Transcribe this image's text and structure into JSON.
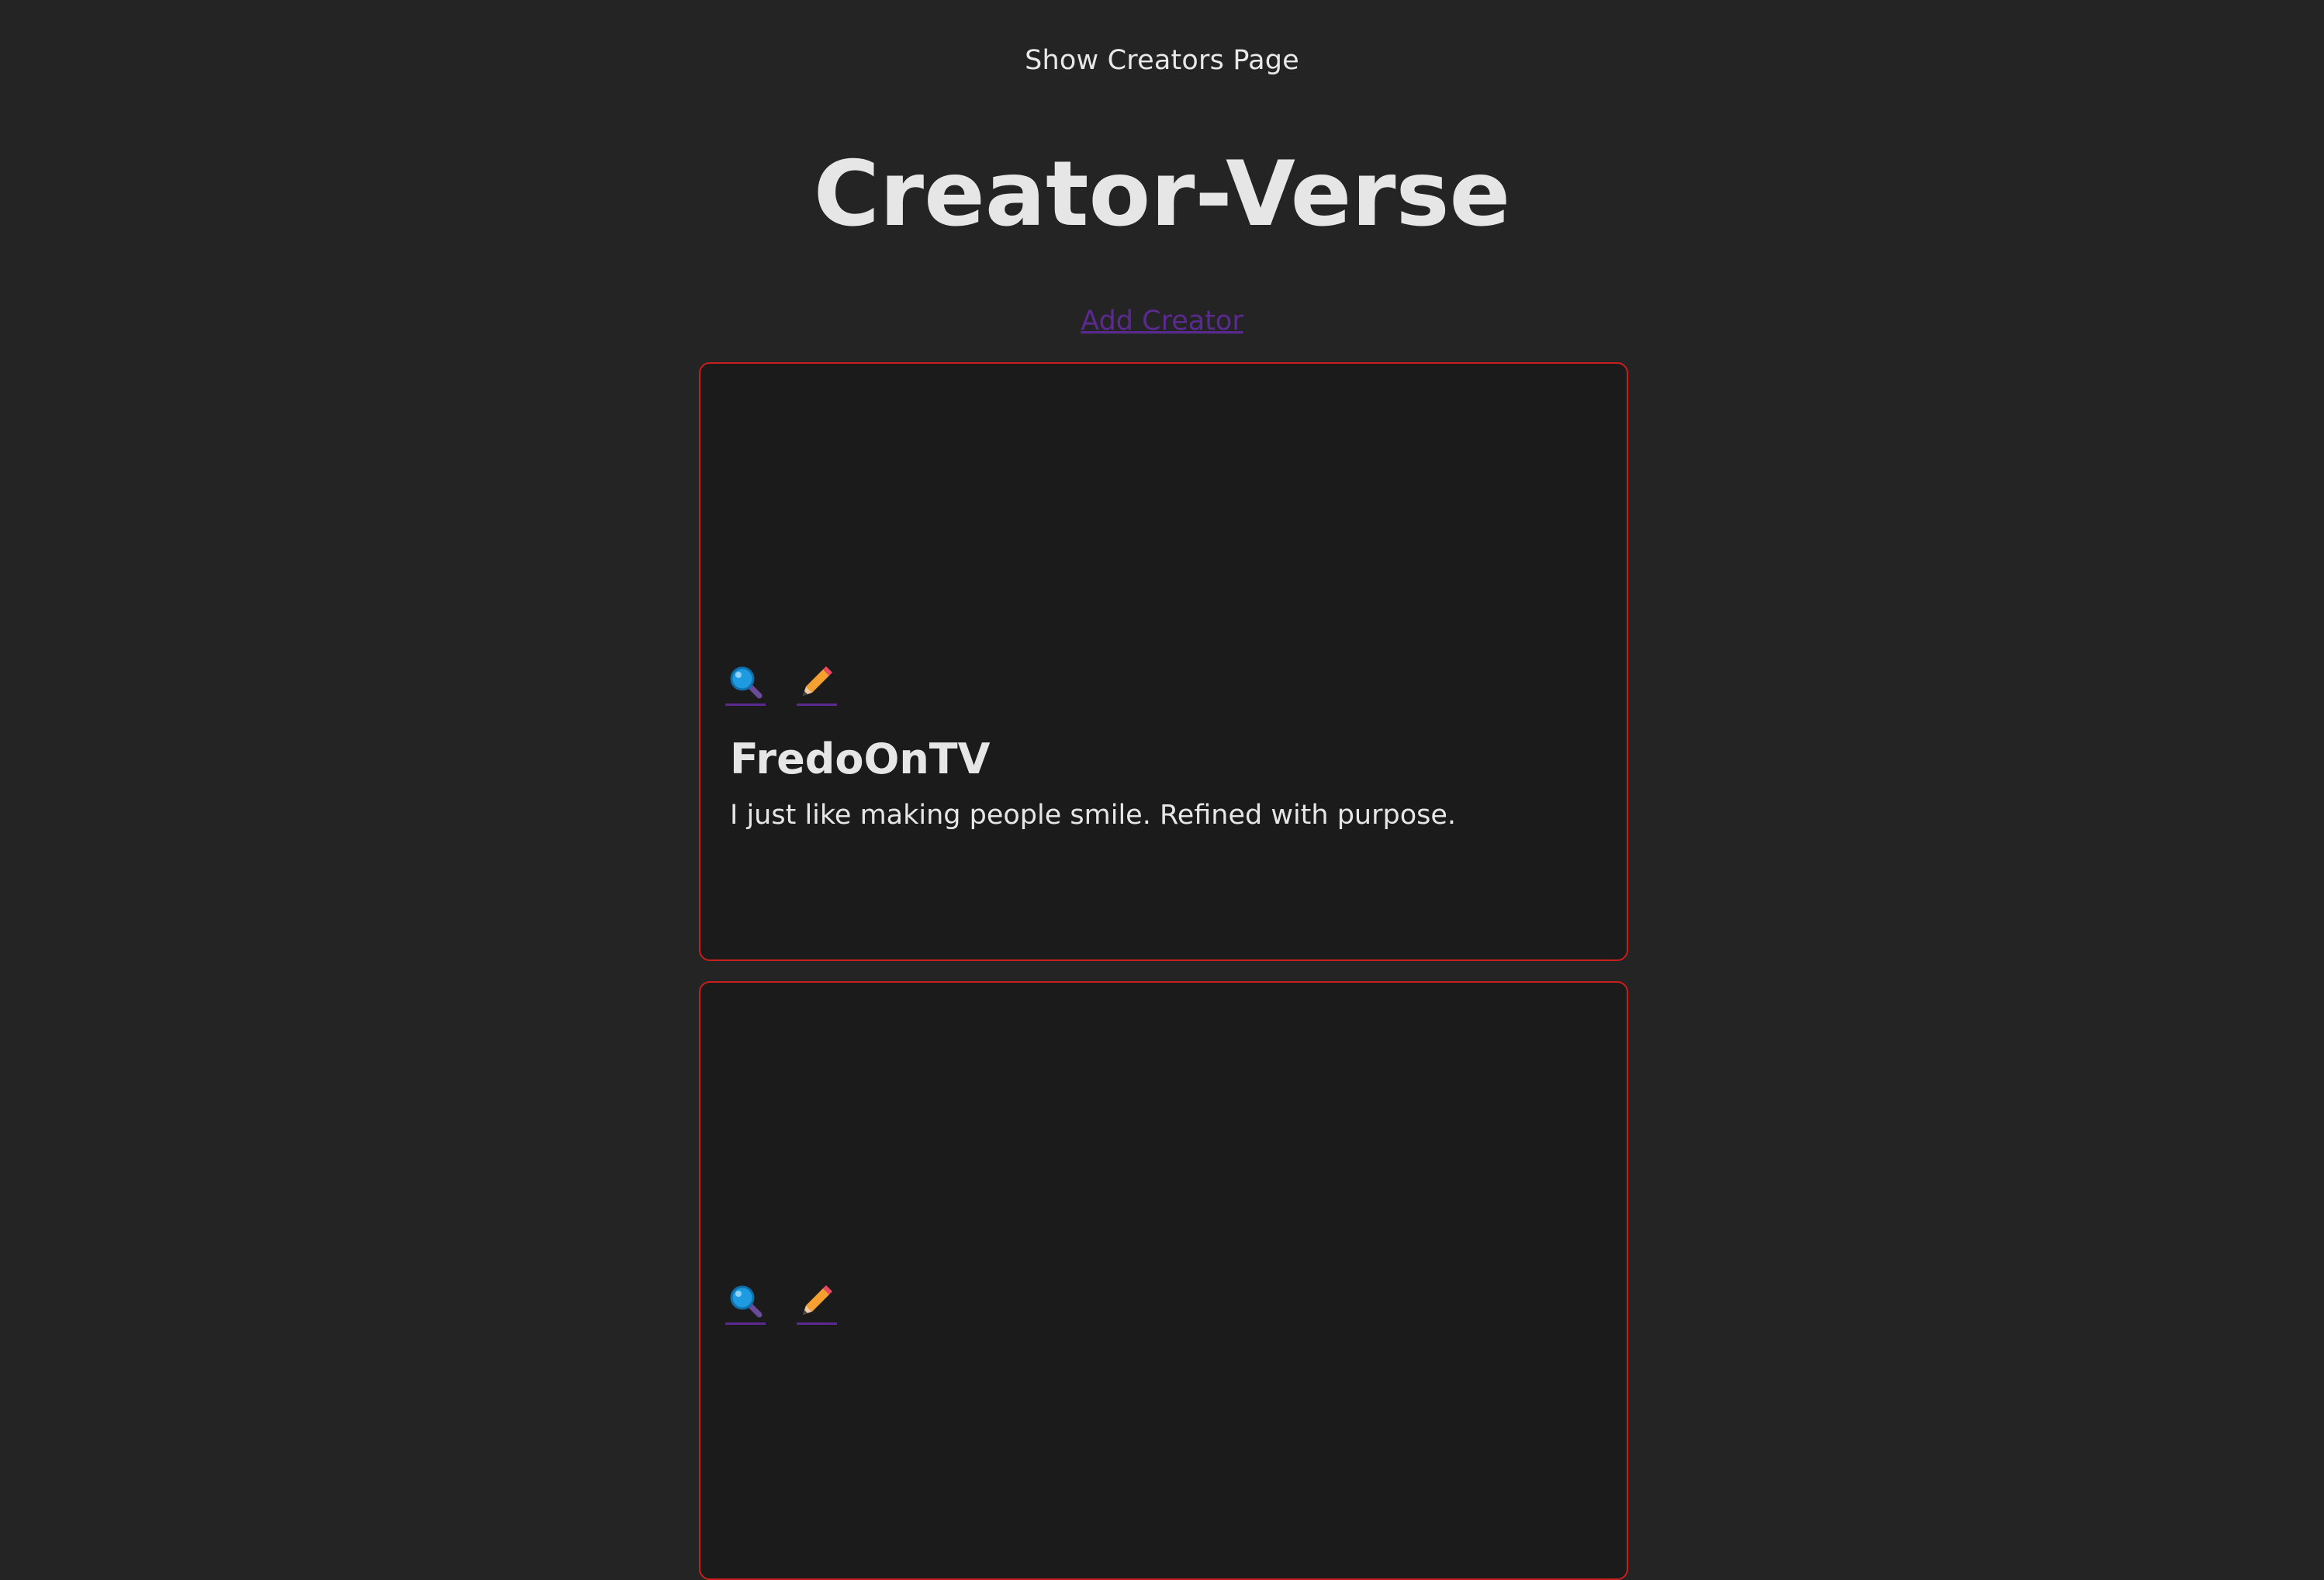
{
  "header": {
    "subtitle": "Show Creators Page",
    "title": "Creator-Verse",
    "add_link": "Add Creator"
  },
  "colors": {
    "background": "#242424",
    "card_background": "#1b1b1b",
    "card_border": "#c81e1e",
    "link": "#5b2a91",
    "text": "#e6e6e6"
  },
  "creators": [
    {
      "name": "FredoOnTV",
      "description": "I just like making people smile. Refined with purpose.",
      "view_icon": "magnifying-glass-icon",
      "edit_icon": "pencil-icon"
    },
    {
      "name": "",
      "description": "",
      "view_icon": "magnifying-glass-icon",
      "edit_icon": "pencil-icon"
    }
  ]
}
